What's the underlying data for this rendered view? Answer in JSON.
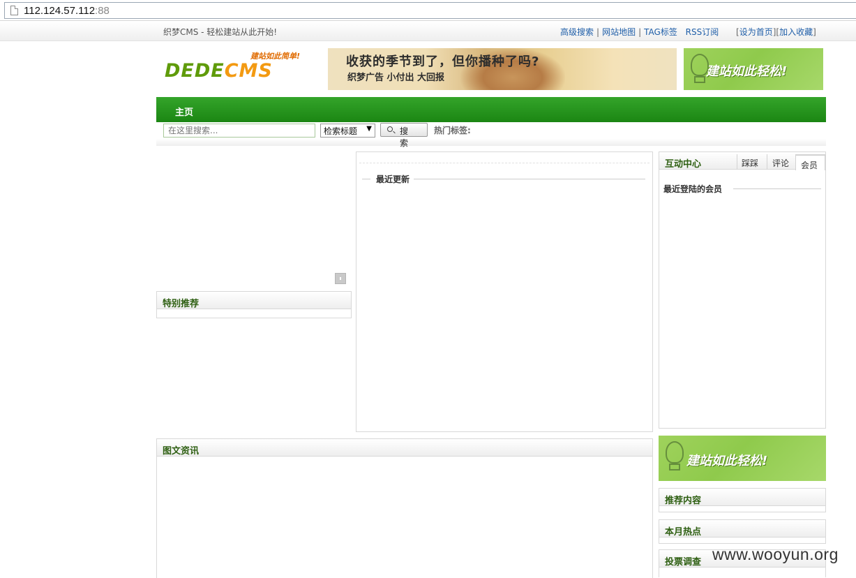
{
  "browser": {
    "url_host": "112.124.57.112",
    "url_port": ":88"
  },
  "topbar": {
    "welcome": "织梦CMS - 轻松建站从此开始!",
    "links": [
      "高级搜索",
      "网站地图",
      "TAG标签",
      "RSS订阅"
    ],
    "bracket_open": "[",
    "bracket_close": "]",
    "set_home": "设为首页",
    "add_favorite": "加入收藏"
  },
  "logo": {
    "slogan": "建站如此简单!",
    "text_left": "DEDE",
    "text_right": "CMS"
  },
  "banner": {
    "headline": "收获的季节到了，但你播种了吗?",
    "subline": "织梦广告 小付出 大回报"
  },
  "side_ad": {
    "text": "建站如此轻松!"
  },
  "nav": {
    "home": "主页"
  },
  "search": {
    "placeholder": "在这里搜索...",
    "select_value": "检索标题",
    "button_label": "搜 索",
    "hot_tags_label": "热门标签:"
  },
  "panels": {
    "special": "特别推荐",
    "recent": "最近更新",
    "interact": "互动中心",
    "tabs": [
      "踩踩",
      "评论",
      "会员"
    ],
    "recent_members": "最近登陆的会员",
    "picnews": "图文资讯",
    "recommend": "推荐内容",
    "monthly": "本月热点",
    "vote": "投票调查"
  },
  "watermark": "www.wooyun.org",
  "colors": {
    "nav_green": "#1b8613",
    "panel_title": "#2e5f12",
    "link_blue": "#1f5ea8"
  }
}
